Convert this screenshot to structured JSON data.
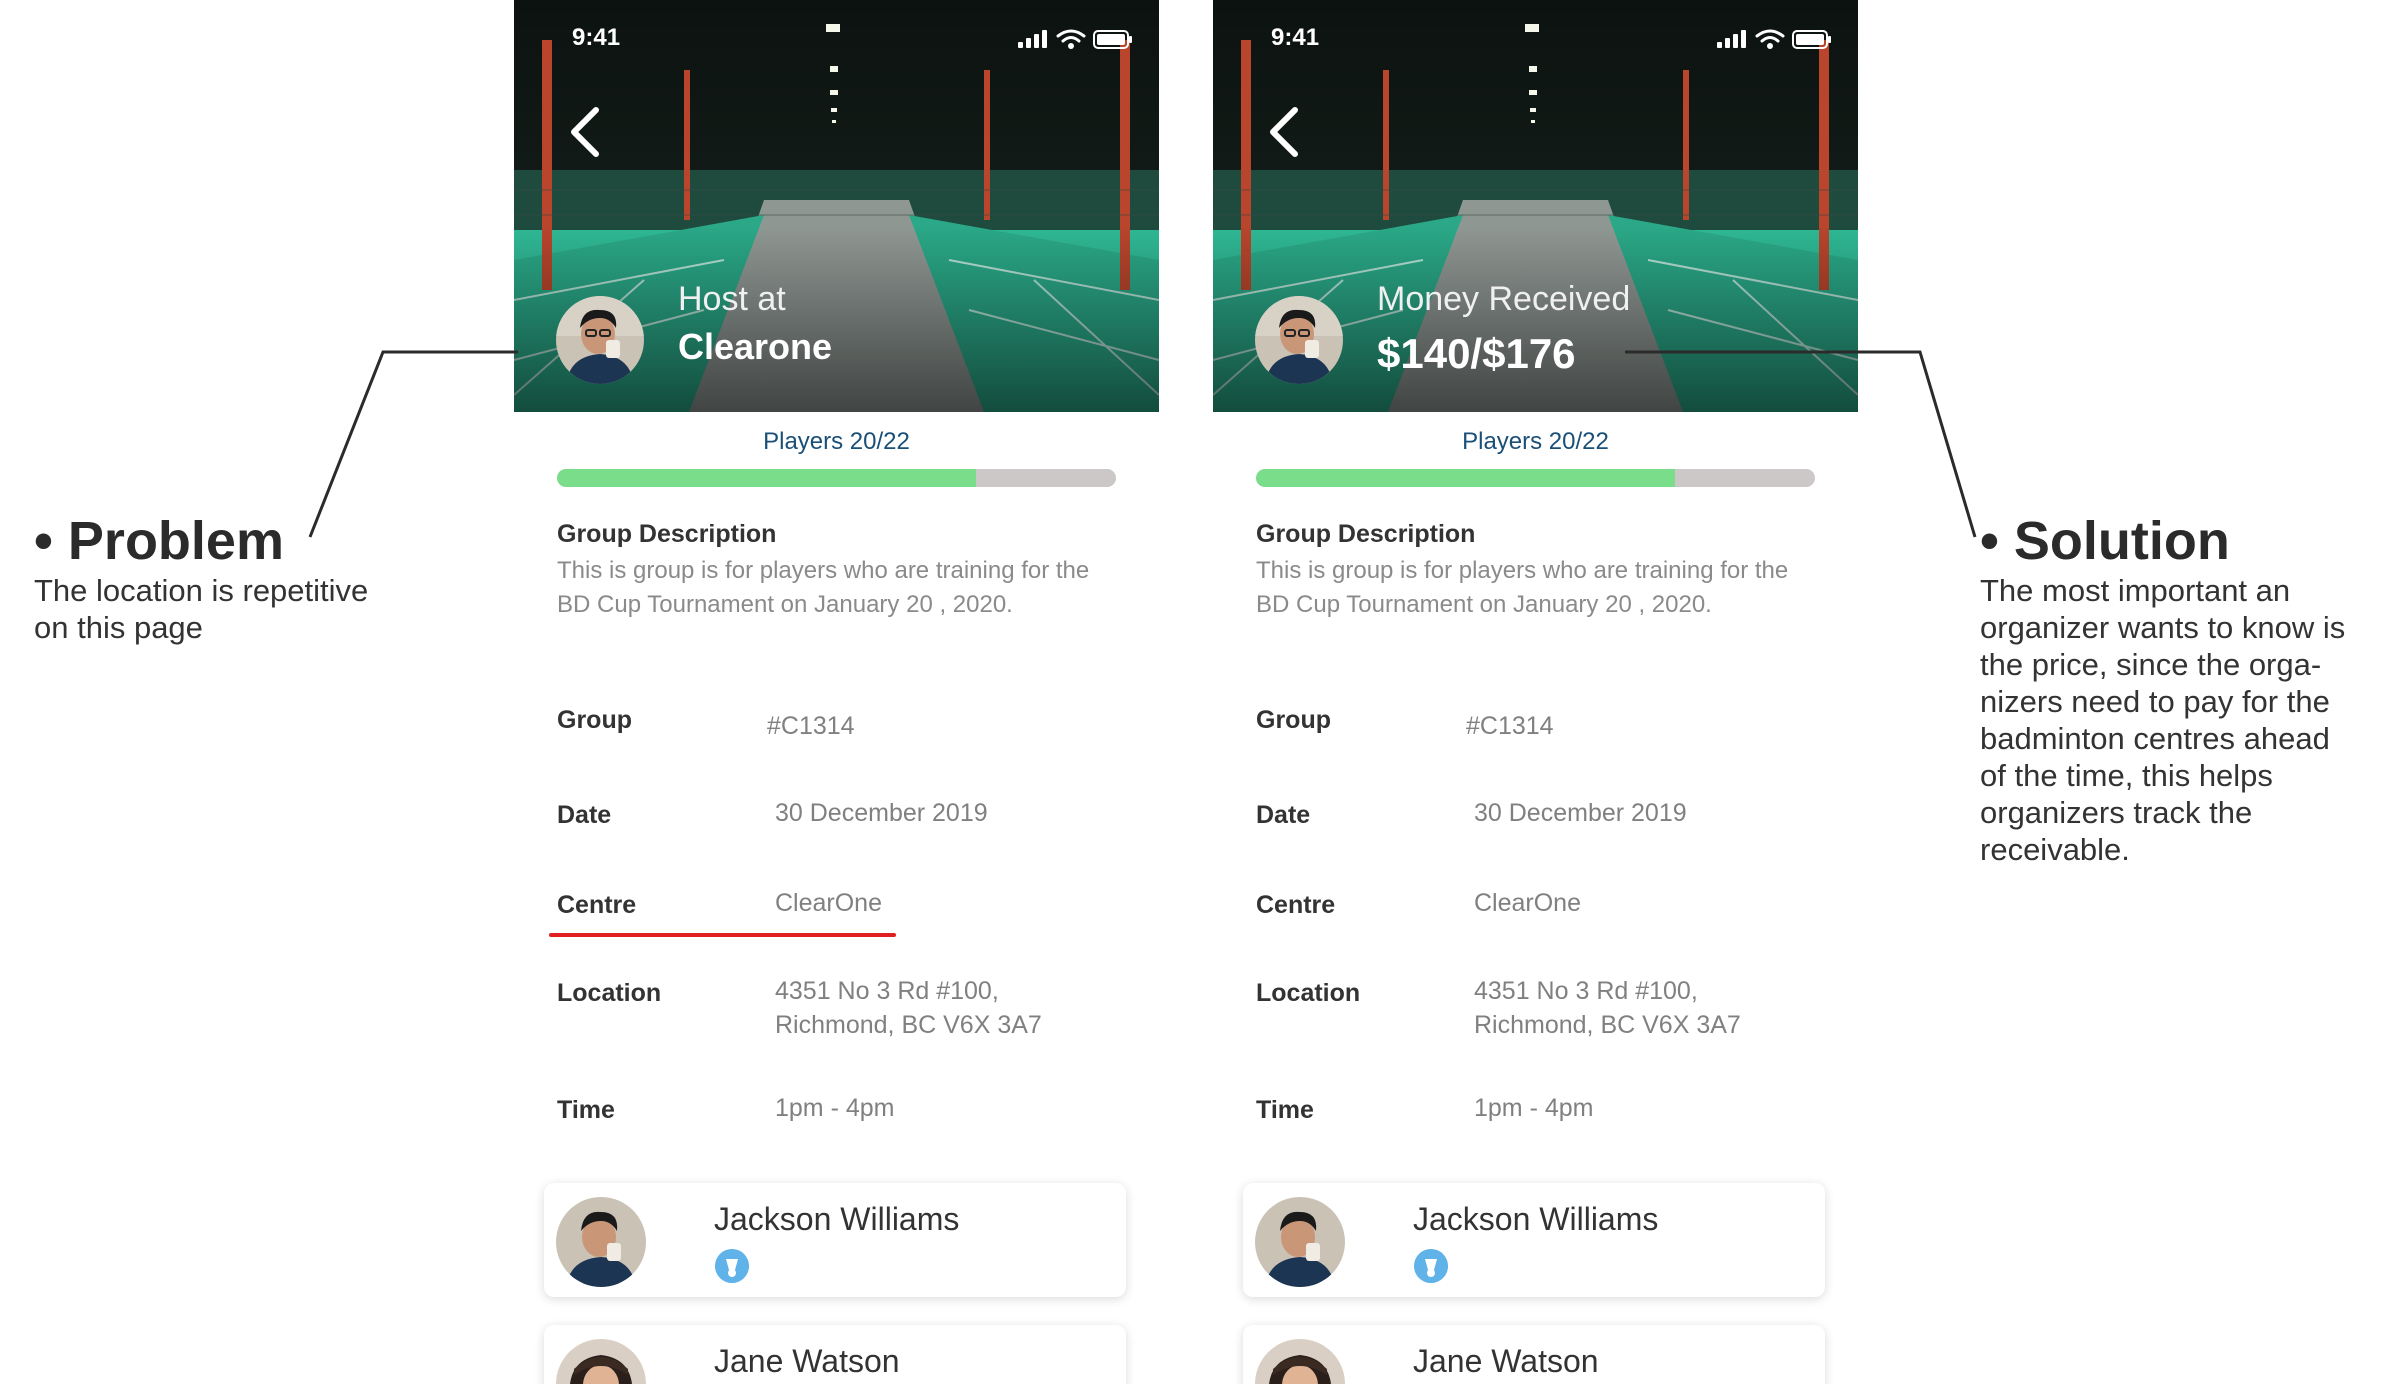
{
  "colors": {
    "accent_blue": "#1a4f78",
    "progress_fill": "#79dd8a",
    "progress_track": "#cdc8c8",
    "highlight_red": "#e02020",
    "badge_blue": "#5fb3e8",
    "court_green": "#2fb894"
  },
  "status_bar": {
    "time": "9:41"
  },
  "problem_screen": {
    "hero_line1": "Host at",
    "hero_line2": "Clearone",
    "players_label": "Players 20/22",
    "players_progress": 0.75
  },
  "solution_screen": {
    "hero_line1": "Money Received",
    "hero_line2": "$140/$176",
    "players_label": "Players 20/22",
    "players_progress": 0.75
  },
  "details": {
    "description_title": "Group Description",
    "description_text": "This is group is for players who are training for the BD Cup Tournament on January 20 , 2020.",
    "group_label": "Group",
    "group_value": "#C1314",
    "date_label": "Date",
    "date_value": "30 December 2019",
    "centre_label": "Centre",
    "centre_value": "ClearOne",
    "location_label": "Location",
    "location_value_line1": "4351 No 3 Rd #100,",
    "location_value_line2": "Richmond, BC V6X 3A7",
    "time_label": "Time",
    "time_value": "1pm - 4pm"
  },
  "members": [
    {
      "name": "Jackson Williams",
      "badge_icon": "shuttlecock-icon"
    },
    {
      "name": "Jane Watson"
    }
  ],
  "annotations": {
    "problem_title": "• Problem",
    "problem_body_line1": "The location is repetitive",
    "problem_body_line2": "on this page",
    "solution_title": "• Solution",
    "solution_body_lines": [
      "The most important an",
      "organizer wants to know is",
      "the price, since the orga-",
      "nizers need to pay for the",
      "badminton centres ahead",
      "of the time, this helps",
      "organizers track the",
      "receivable."
    ]
  }
}
